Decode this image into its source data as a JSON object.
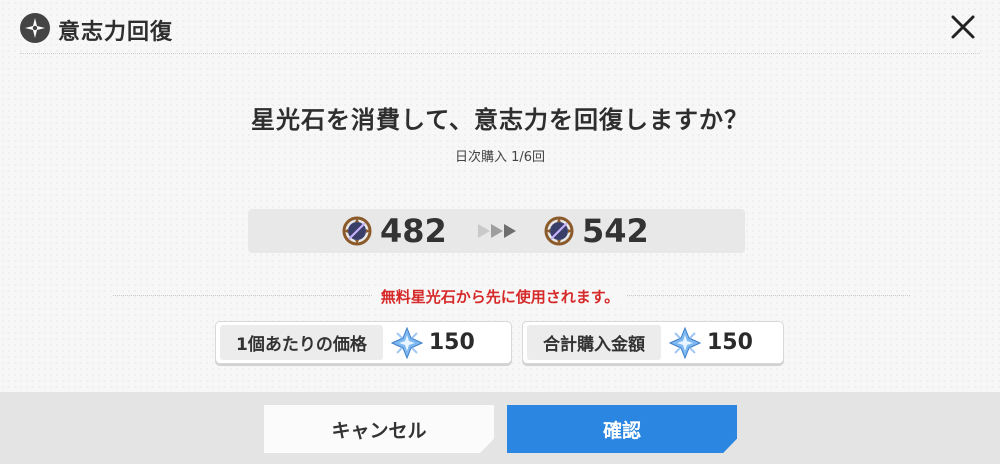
{
  "header": {
    "title": "意志力回復",
    "icon": "compass-star-icon",
    "close_icon": "close-icon"
  },
  "question": "星光石を消費して、意志力を回復しますか？",
  "daily_purchase": "日次購入 1/6回",
  "willpower": {
    "current": "482",
    "after": "542",
    "icon": "willpower-orb-icon",
    "arrow_icon": "double-arrow-right-icon"
  },
  "notice": "無料星光石から先に使用されます。",
  "prices": {
    "unit_label": "1個あたりの価格",
    "unit_value": "150",
    "total_label": "合計購入金額",
    "total_value": "150",
    "gem_icon": "star-crystal-icon"
  },
  "buttons": {
    "cancel": "キャンセル",
    "confirm": "確認"
  },
  "colors": {
    "accent": "#2a86e0",
    "warning": "#d62a2a"
  }
}
